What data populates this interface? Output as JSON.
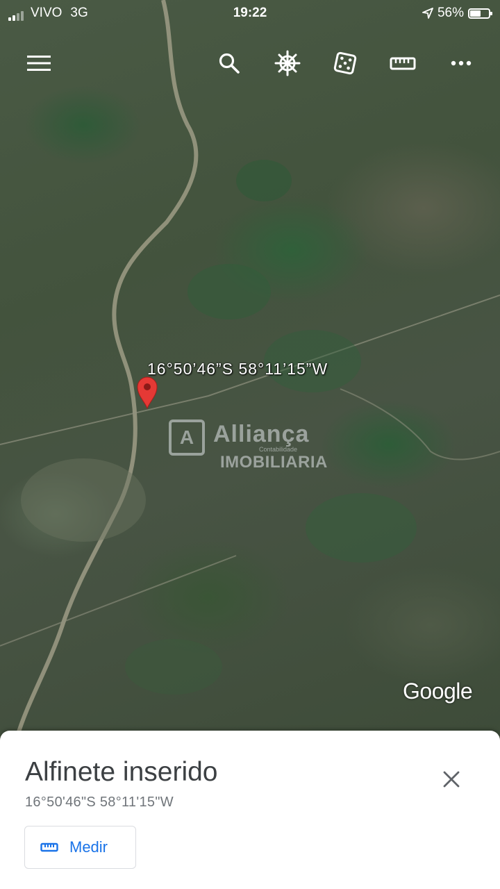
{
  "status_bar": {
    "carrier": "VIVO",
    "network": "3G",
    "time": "19:22",
    "battery_text": "56%",
    "battery_level": 0.56,
    "signal_bars": 2,
    "signal_total": 4
  },
  "toolbar": {
    "menu_icon": "menu-icon",
    "search_icon": "search-icon",
    "voyager_icon": "ship-wheel-icon",
    "feeling_lucky_icon": "dice-icon",
    "measure_icon": "ruler-icon",
    "more_icon": "more-horizontal-icon"
  },
  "map": {
    "pin_label": "16°50’46”S 58°11’15”W",
    "watermark": {
      "logo_letter": "A",
      "name": "Alliança",
      "subtitle": "Contabilidade",
      "type": "IMOBILIARIA"
    },
    "attribution": "Google"
  },
  "sheet": {
    "title": "Alfinete inserido",
    "coordinates": "16°50'46\"S 58°11'15\"W",
    "measure_label": "Medir",
    "close_icon": "close-icon"
  },
  "colors": {
    "accent": "#1a73e8",
    "pin": "#e53935",
    "title_text": "#3c4043",
    "secondary_text": "#70757a"
  }
}
